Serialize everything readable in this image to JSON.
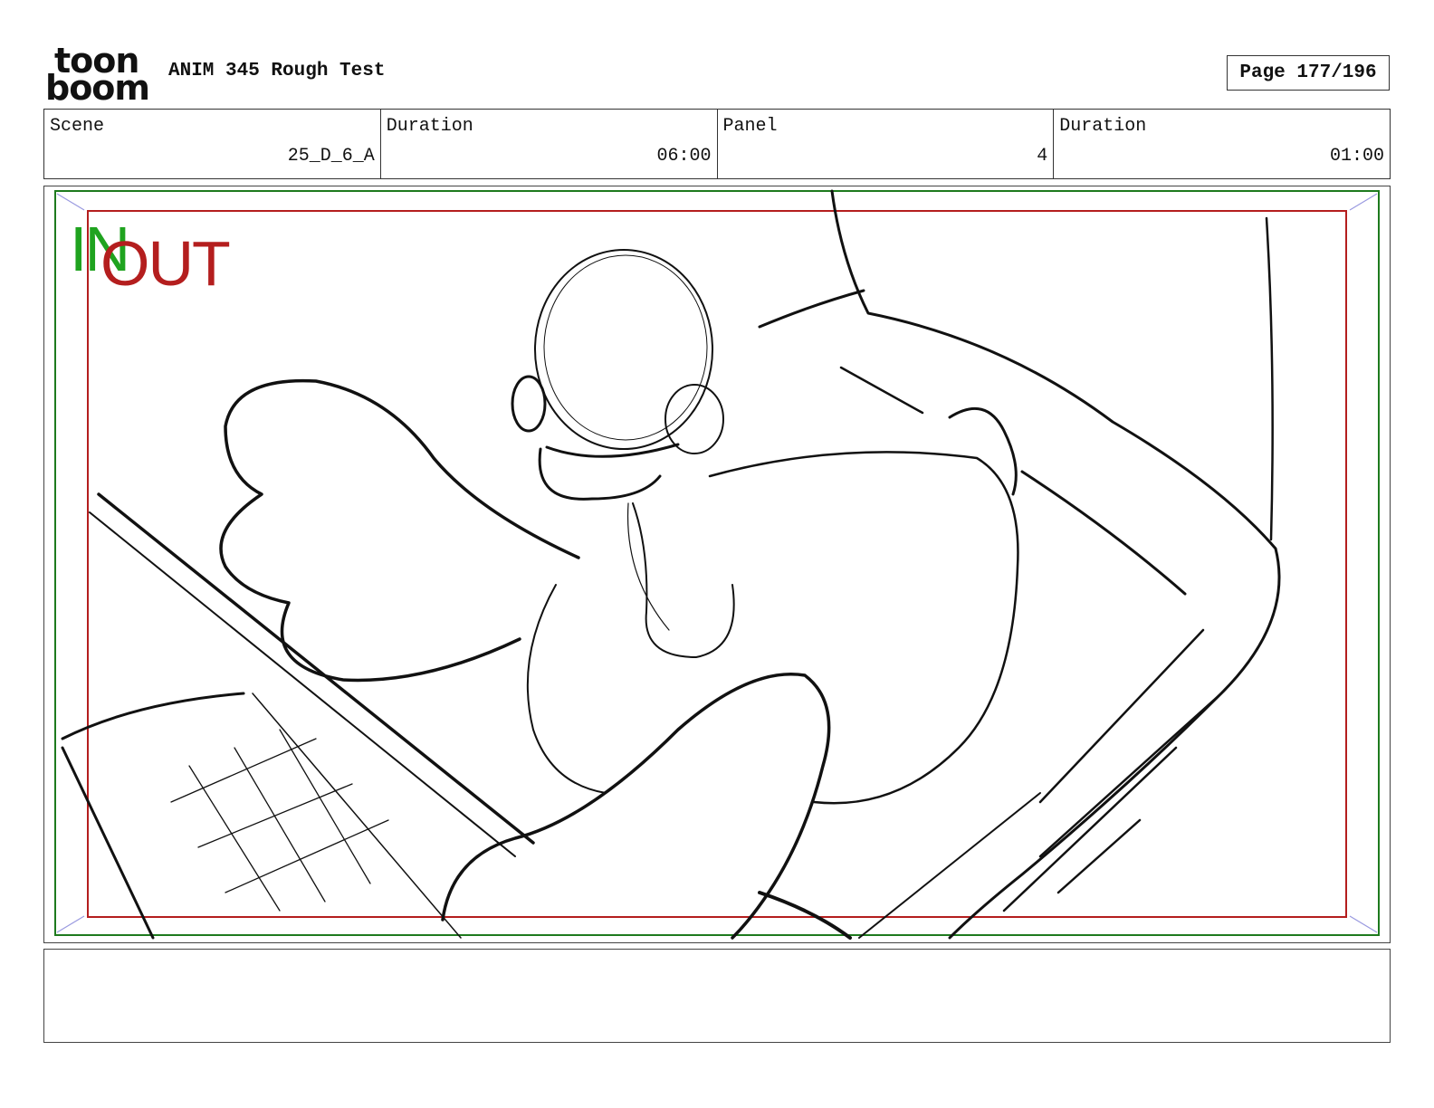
{
  "header": {
    "logo_top": "toon",
    "logo_bottom": "boom",
    "title": "ANIM 345 Rough Test",
    "page": "Page 177/196"
  },
  "info": {
    "scene_label": "Scene",
    "scene_value": "25_D_6_A",
    "scene_duration_label": "Duration",
    "scene_duration_value": "06:00",
    "panel_label": "Panel",
    "panel_value": "4",
    "panel_duration_label": "Duration",
    "panel_duration_value": "01:00"
  },
  "panel": {
    "in_marker": "IN",
    "out_marker": "OUT",
    "in_frame_color": "#1e7a1e",
    "out_frame_color": "#b41e1e"
  },
  "notes": {
    "text": ""
  }
}
